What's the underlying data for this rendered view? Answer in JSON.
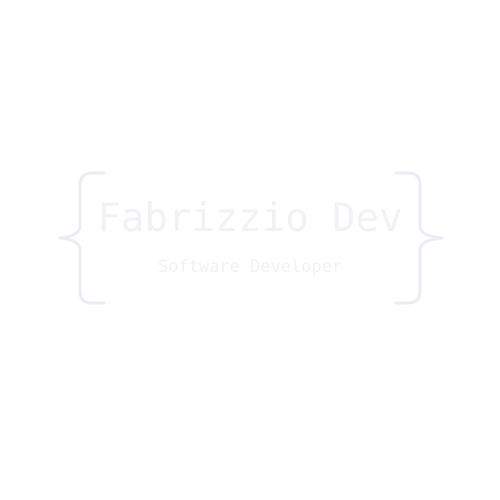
{
  "logo": {
    "name": "Fabrizzio Dev",
    "role": "Software Developer",
    "text_color": "#f1f1f6",
    "brace_color": "#ececf5",
    "background": "#ffffff",
    "brace_icon": "curly-brace-icon"
  }
}
